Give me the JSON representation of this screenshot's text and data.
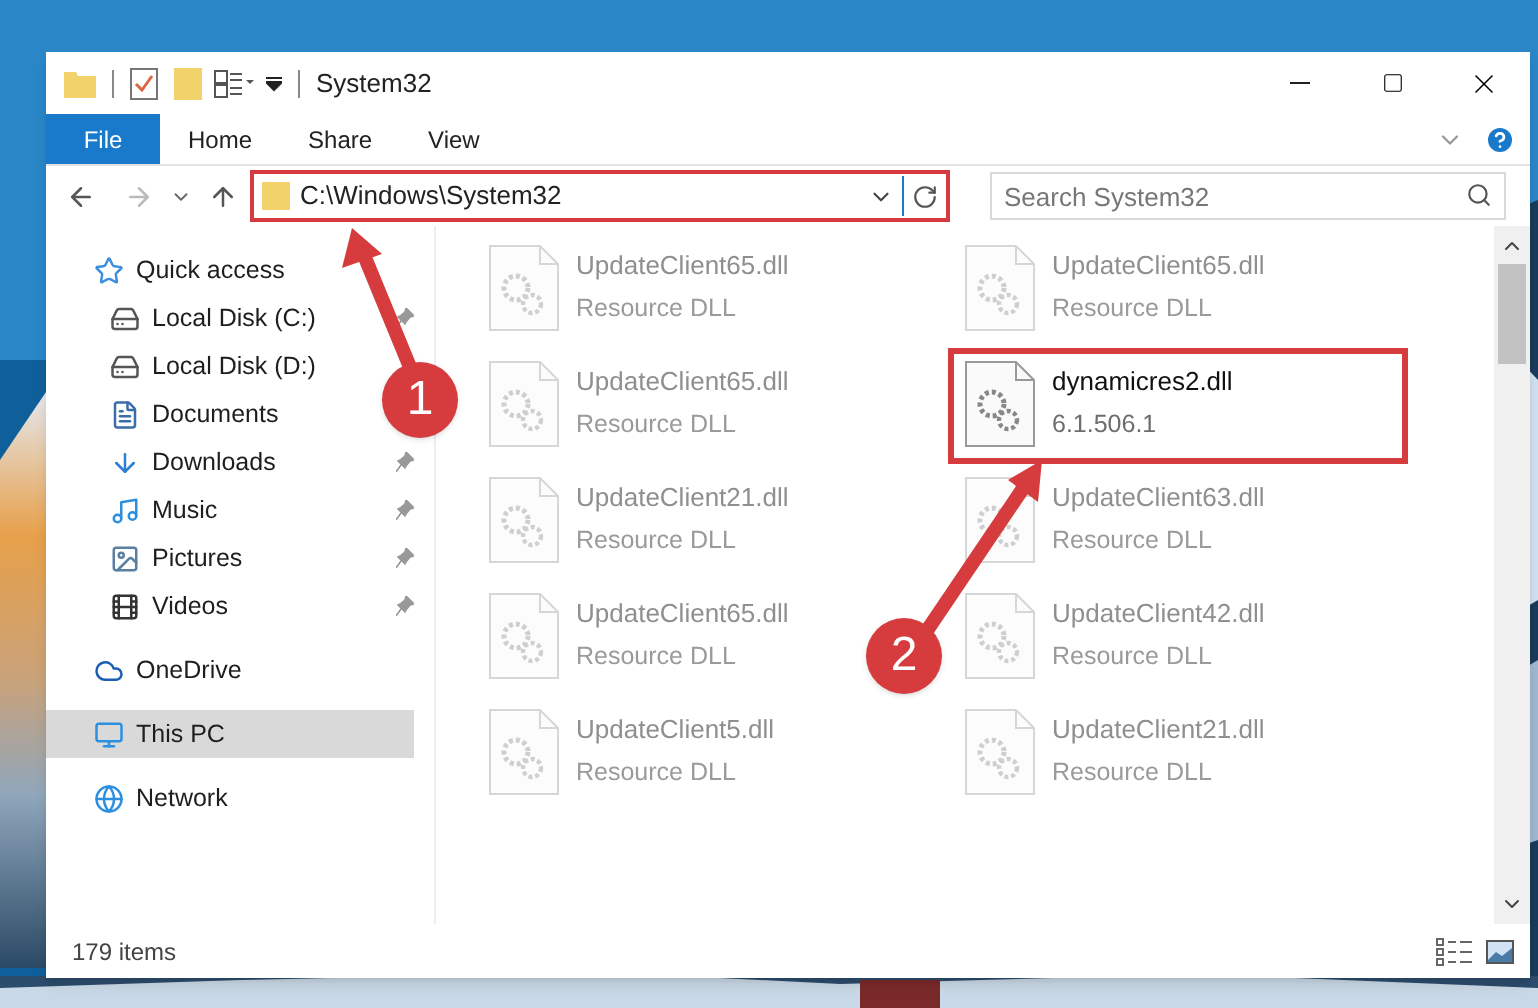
{
  "window": {
    "title": "System32"
  },
  "ribbon_tabs": [
    {
      "label": "File",
      "kind": "file"
    },
    {
      "label": "Home",
      "kind": "tab"
    },
    {
      "label": "Share",
      "kind": "tab"
    },
    {
      "label": "View",
      "kind": "tab"
    }
  ],
  "address_bar": {
    "path": "C:\\Windows\\System32",
    "highlighted": true
  },
  "search": {
    "placeholder": "Search System32"
  },
  "navigation": [
    {
      "label": "Quick access",
      "kind": "star",
      "selected": false,
      "children": [
        {
          "label": "Local Disk (C:)",
          "kind": "drive",
          "pinned": true,
          "selected": false
        },
        {
          "label": "Local Disk (D:)",
          "kind": "drive",
          "selected": false
        },
        {
          "label": "Documents",
          "kind": "documents",
          "selected": false
        },
        {
          "label": "Downloads",
          "kind": "downloads",
          "pinned": true,
          "selected": false
        },
        {
          "label": "Music",
          "kind": "music",
          "pinned": true,
          "selected": false
        },
        {
          "label": "Pictures",
          "kind": "pictures",
          "pinned": true,
          "selected": false
        },
        {
          "label": "Videos",
          "kind": "videos",
          "pinned": true,
          "selected": false
        }
      ]
    },
    {
      "label": "OneDrive",
      "kind": "cloud",
      "selected": false
    },
    {
      "label": "This PC",
      "kind": "pc",
      "selected": true
    },
    {
      "label": "Network",
      "kind": "network",
      "selected": false
    }
  ],
  "files": [
    {
      "name": "UpdateClient65.dll",
      "detail": "Resource DLL",
      "faded": true,
      "highlighted": false
    },
    {
      "name": "UpdateClient65.dll",
      "detail": "Resource DLL",
      "faded": true,
      "highlighted": false
    },
    {
      "name": "UpdateClient65.dll",
      "detail": "Resource DLL",
      "faded": true,
      "highlighted": false
    },
    {
      "name": "dynamicres2.dll",
      "detail": "6.1.506.1",
      "faded": false,
      "highlighted": true
    },
    {
      "name": "UpdateClient21.dll",
      "detail": "Resource DLL",
      "faded": true,
      "highlighted": false
    },
    {
      "name": "UpdateClient63.dll",
      "detail": "Resource DLL",
      "faded": true,
      "highlighted": false
    },
    {
      "name": "UpdateClient65.dll",
      "detail": "Resource DLL",
      "faded": true,
      "highlighted": false
    },
    {
      "name": "UpdateClient42.dll",
      "detail": "Resource DLL",
      "faded": true,
      "highlighted": false
    },
    {
      "name": "UpdateClient5.dll",
      "detail": "Resource DLL",
      "faded": true,
      "highlighted": false
    },
    {
      "name": "UpdateClient21.dll",
      "detail": "Resource DLL",
      "faded": true,
      "highlighted": false
    }
  ],
  "status_bar": {
    "item_count": "179 items"
  },
  "annotations": [
    {
      "number": "1"
    },
    {
      "number": "2"
    }
  ]
}
